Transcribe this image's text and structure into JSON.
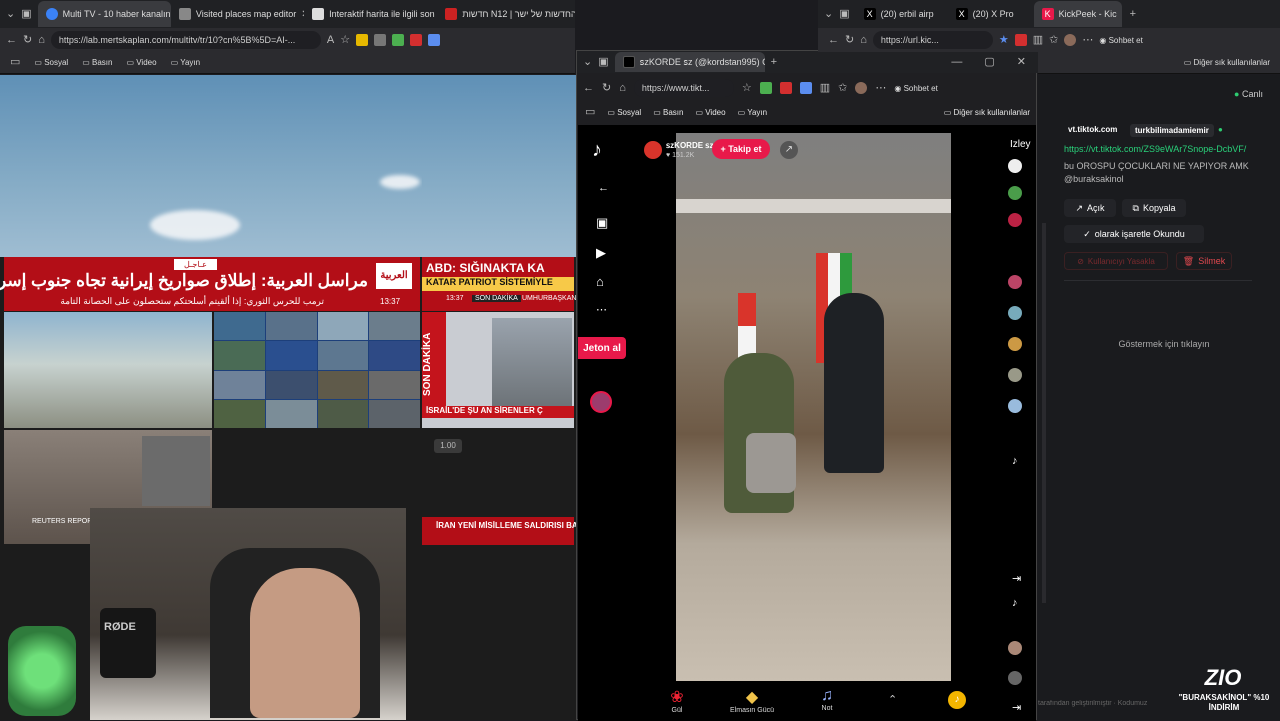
{
  "left_browser": {
    "tabs": [
      {
        "label": "Multi TV - 10 haber kanalını a",
        "active": true,
        "favicon_color": "#3b82f6"
      },
      {
        "label": "Visited places map editor",
        "active": false,
        "favicon_color": "#888"
      },
      {
        "label": "Interaktif harita ile ilgili son İran ha",
        "active": false,
        "favicon_color": "#ddd"
      },
      {
        "label": "חדשות N12 | אתר החדשות של ישר",
        "active": false,
        "favicon_color": "#c22"
      }
    ],
    "url": "https://lab.mertskaplan.com/multitv/tr/10?cn%5B%5D=AI-...",
    "bookmarks": [
      "Sosyal",
      "Basın",
      "Video",
      "Yayın"
    ],
    "news_alarabiya": {
      "badge": "عـاجـل",
      "headline": "مراسل العربية: إطلاق صواريخ إيرانية تجاه جنوب إسرائيل",
      "sub": "ترمب للحرس الثوري: إذا ألقيتم أسلحتكم ستحصلون على الحصانة التامة",
      "time": "13:37",
      "logo": "العربية"
    },
    "news_turk": {
      "title": "ABD: SIĞINAKTA KA",
      "sub": "KATAR PATRIOT SİSTEMİYLE",
      "time": "13:37",
      "tag": "SON DAKİKA",
      "tag2": "UMHURBAŞKAN"
    },
    "news_israel": "İSRAİL'DE ŞU AN SİRENLER Ç",
    "news_iran": "İRAN YENİ MİSİLLEME SALDIRISI BAŞLAT",
    "vertical_tag": "SON DAKİKA",
    "speed": "1.00",
    "ticker": "REUTERS REPORT: ..."
  },
  "tiktok_window": {
    "tab_title": "ꜱᴢKORDE ꜱᴢ (@kordstan995) C",
    "url": "https://www.tikt...",
    "bookmarks": [
      "Sosyal",
      "Basın",
      "Video",
      "Yayın"
    ],
    "bookmarks_other": "Diğer sık kullanılanlar",
    "edge_chat": "Sohbet et",
    "profile_name": "ꜱᴢKORDE ꜱᴢ",
    "likes": "♥ 151.2K",
    "follow": "+ Takip et",
    "jeton": "Jeton al",
    "izle": "İzley",
    "bottom_gifts": [
      {
        "label": "Gül",
        "icon": "rose-icon"
      },
      {
        "label": "Elmasın Gücü",
        "icon": "diamond-icon"
      },
      {
        "label": "Not",
        "icon": "note-icon"
      }
    ]
  },
  "right_browser": {
    "tabs": [
      {
        "label": "(20) erbil airp",
        "favicon": "X"
      },
      {
        "label": "(20) X Pro",
        "favicon": "X"
      },
      {
        "label": "KickPeek - Kic",
        "favicon": "K",
        "active": true
      }
    ],
    "url": "https://url.kic...",
    "edge_chat": "Sohbet et",
    "bookmarks_other": "Diğer sık kullanılanlar",
    "live": "Canlı",
    "chips": [
      "vt.tiktok.com",
      "turkbilimadamiemir"
    ],
    "link": "https://vt.tiktok.com/ZS9eWAr7Snope-DcbVF/",
    "message": "bu OROSPU ÇOCUKLARI NE YAPIYOR AMK @buraksakinol",
    "open": "Açık",
    "copy": "Kopyala",
    "mark_read": "olarak işaretle Okundu",
    "ban": "Kullanıcıyı Yasakla",
    "delete": "Silmek",
    "placeholder": "Göstermek için tıklayın",
    "footer": "tarafından geliştirilmiştir · Kodumuz",
    "promo_logo": "ZIO",
    "promo_text": "\"BURAKSAKİNOL\" %10 İNDİRİM"
  },
  "webcam": {
    "mic_brand": "RØDE"
  }
}
